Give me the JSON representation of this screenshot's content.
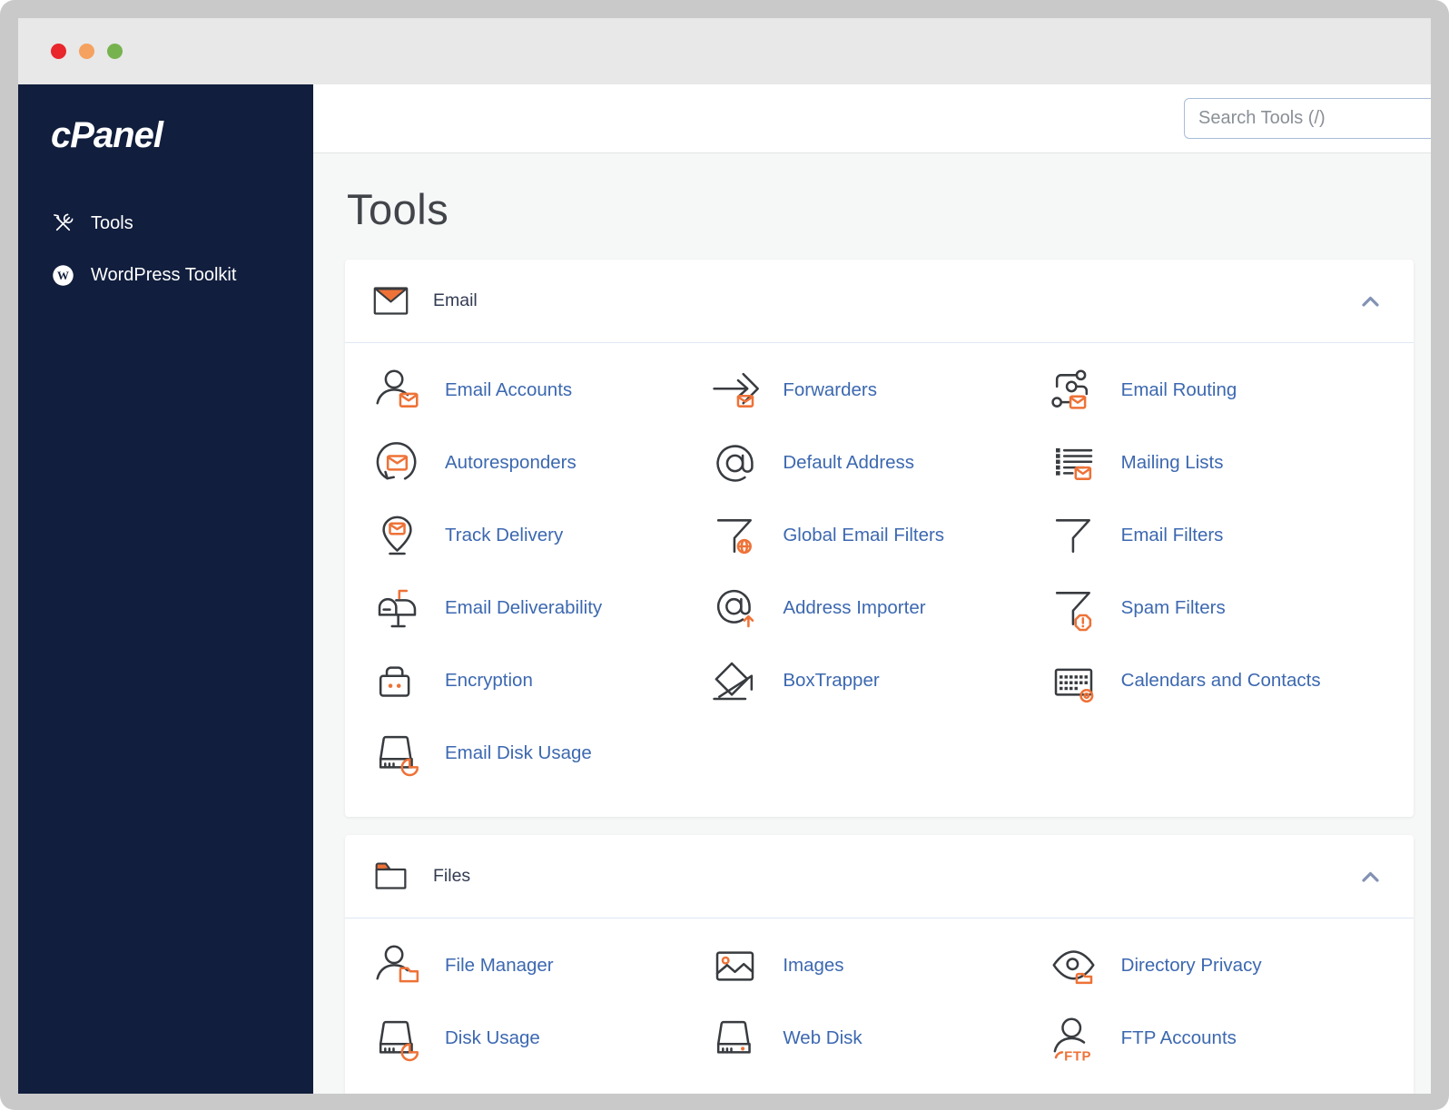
{
  "window": {
    "traffic_lights": [
      {
        "name": "close",
        "color": "#e8262c"
      },
      {
        "name": "minimize",
        "color": "#f5a15f"
      },
      {
        "name": "zoom",
        "color": "#76b34f"
      }
    ]
  },
  "sidebar": {
    "logo": "cPanel",
    "items": [
      {
        "label": "Tools",
        "icon": "tools-icon"
      },
      {
        "label": "WordPress Toolkit",
        "icon": "wordpress-icon"
      }
    ]
  },
  "header": {
    "search_placeholder": "Search Tools (/)"
  },
  "page": {
    "title": "Tools"
  },
  "sections": [
    {
      "label": "Email",
      "icon": "email-section-icon",
      "items": [
        {
          "label": "Email Accounts",
          "icon": "email-accounts-icon"
        },
        {
          "label": "Forwarders",
          "icon": "forwarders-icon"
        },
        {
          "label": "Email Routing",
          "icon": "email-routing-icon"
        },
        {
          "label": "Autoresponders",
          "icon": "autoresponders-icon"
        },
        {
          "label": "Default Address",
          "icon": "default-address-icon"
        },
        {
          "label": "Mailing Lists",
          "icon": "mailing-lists-icon"
        },
        {
          "label": "Track Delivery",
          "icon": "track-delivery-icon"
        },
        {
          "label": "Global Email Filters",
          "icon": "global-email-filters-icon"
        },
        {
          "label": "Email Filters",
          "icon": "email-filters-icon"
        },
        {
          "label": "Email Deliverability",
          "icon": "email-deliverability-icon"
        },
        {
          "label": "Address Importer",
          "icon": "address-importer-icon"
        },
        {
          "label": "Spam Filters",
          "icon": "spam-filters-icon"
        },
        {
          "label": "Encryption",
          "icon": "encryption-icon"
        },
        {
          "label": "BoxTrapper",
          "icon": "boxtrapper-icon"
        },
        {
          "label": "Calendars and Contacts",
          "icon": "calendars-contacts-icon"
        },
        {
          "label": "Email Disk Usage",
          "icon": "email-disk-usage-icon"
        }
      ]
    },
    {
      "label": "Files",
      "icon": "files-section-icon",
      "items": [
        {
          "label": "File Manager",
          "icon": "file-manager-icon"
        },
        {
          "label": "Images",
          "icon": "images-icon"
        },
        {
          "label": "Directory Privacy",
          "icon": "directory-privacy-icon"
        },
        {
          "label": "Disk Usage",
          "icon": "disk-usage-icon"
        },
        {
          "label": "Web Disk",
          "icon": "web-disk-icon"
        },
        {
          "label": "FTP Accounts",
          "icon": "ftp-accounts-icon"
        }
      ]
    }
  ],
  "colors": {
    "sidebar_navy": "#111e3d",
    "link_blue": "#3c68b0",
    "accent_orange": "#ee7237",
    "content_background": "#f6f7f7",
    "window_frame": "#c9c9c9",
    "titlebar": "#e8e8e8"
  }
}
